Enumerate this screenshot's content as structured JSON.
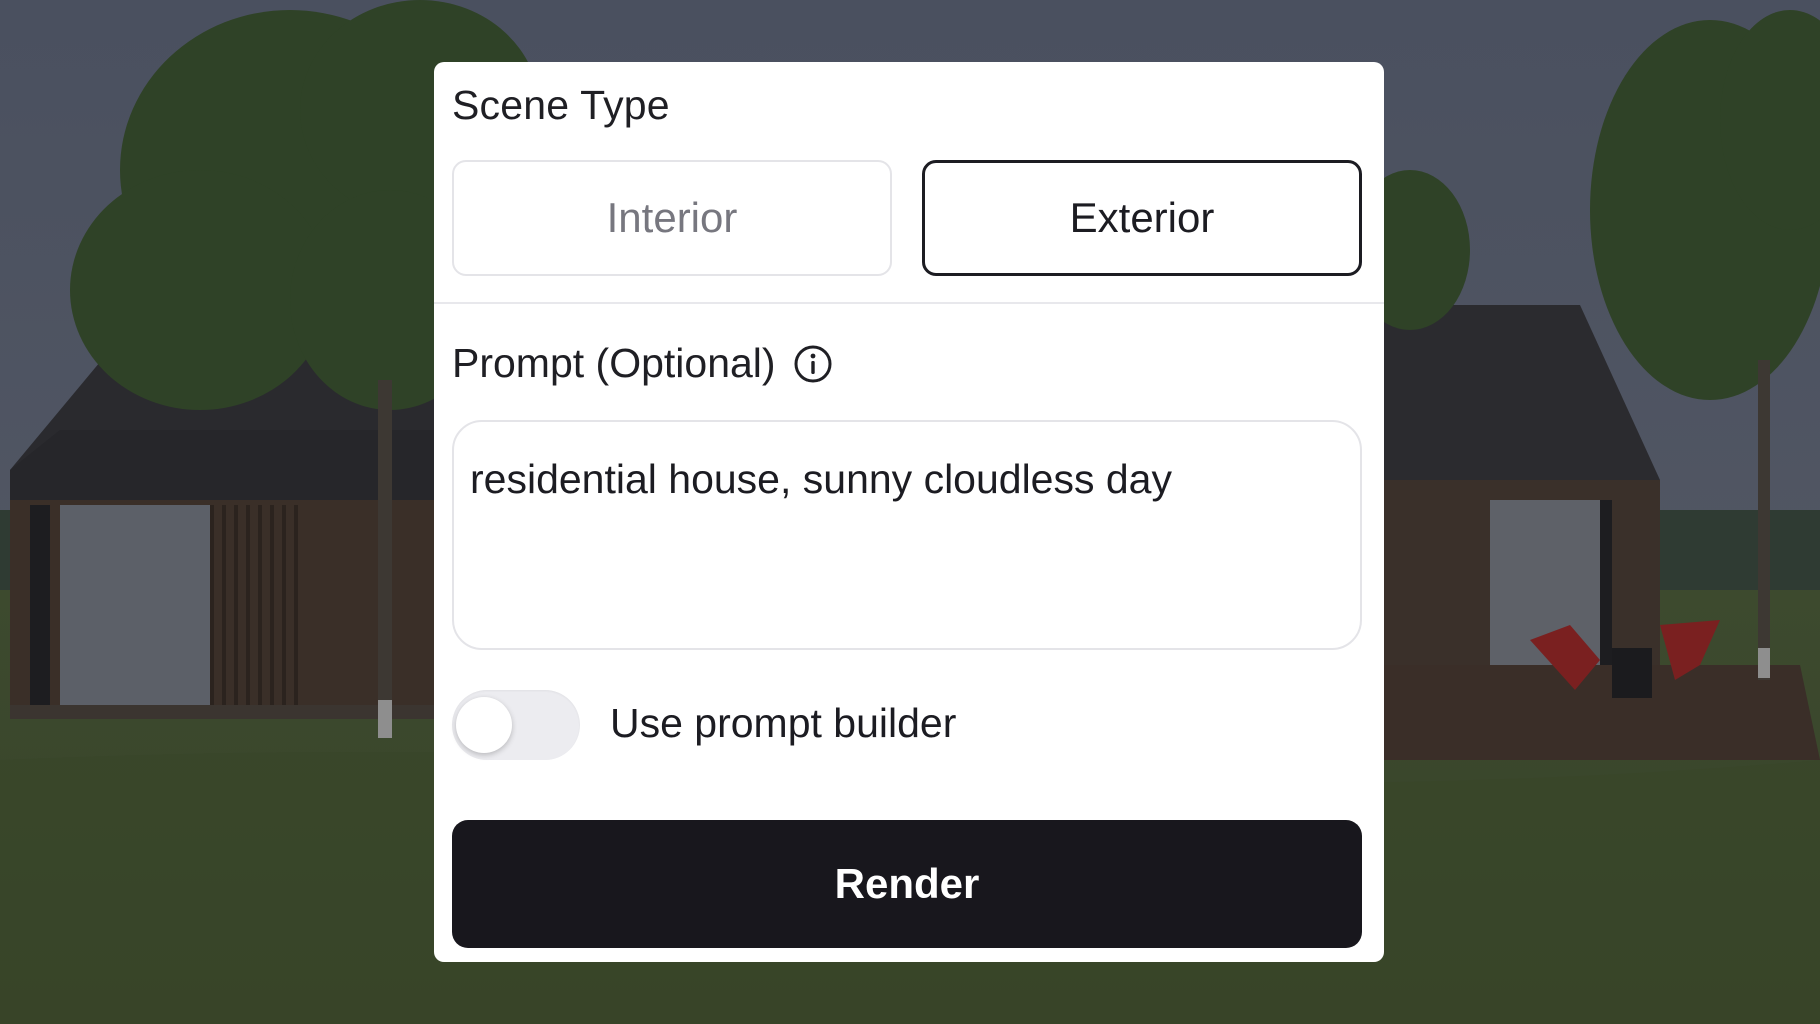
{
  "scene_type": {
    "title": "Scene Type",
    "options": [
      {
        "label": "Interior",
        "selected": false
      },
      {
        "label": "Exterior",
        "selected": true
      }
    ]
  },
  "prompt": {
    "label": "Prompt (Optional)",
    "info_icon": "info-icon",
    "value": "residential house, sunny cloudless day"
  },
  "prompt_builder": {
    "label": "Use prompt builder",
    "enabled": false
  },
  "render_button": {
    "label": "Render"
  },
  "colors": {
    "primary_button": "#18171d",
    "panel_background": "#ffffff",
    "background_dim": "#4b5160"
  }
}
